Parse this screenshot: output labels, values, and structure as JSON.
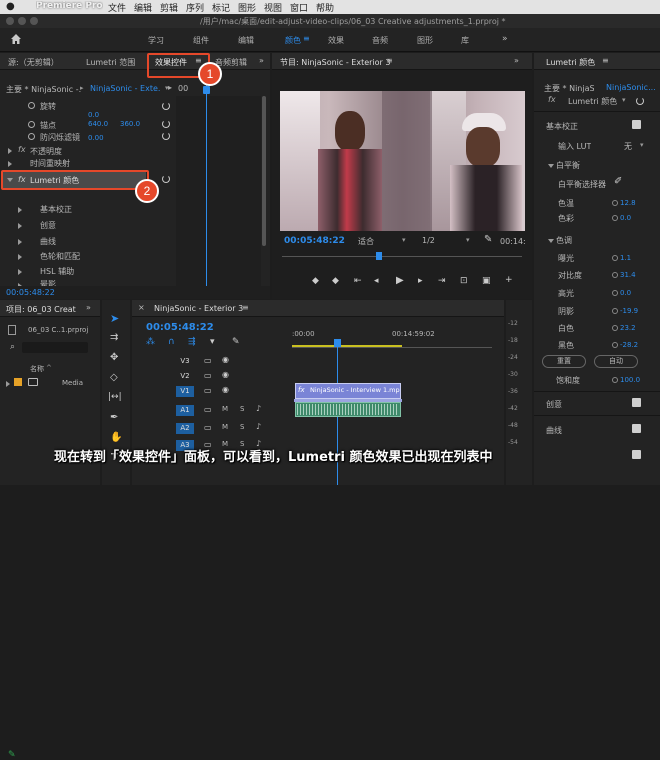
{
  "menubar": {
    "app": "Premiere Pro",
    "items": [
      "文件",
      "编辑",
      "剪辑",
      "序列",
      "标记",
      "图形",
      "视图",
      "窗口",
      "帮助"
    ]
  },
  "titlebar": {
    "path": "/用户/mac/桌面/edit-adjust-video-clips/06_03 Creative adjustments_1.prproj *"
  },
  "workspaces": {
    "items": [
      "学习",
      "组件",
      "编辑",
      "颜色",
      "效果",
      "音频",
      "图形",
      "库"
    ],
    "active": "颜色"
  },
  "source_panel": {
    "tab_source": "源:（无剪辑）",
    "tab_scope": "Lumetri 范围",
    "tab_effects": "效果控件",
    "tab_audio": "音频剪辑",
    "master": "主要 * NinjaSonic -...",
    "seq": "NinjaSonic - Exte...",
    "time0": "00",
    "rows": {
      "rotate": "旋转",
      "rotate_val": "0.0",
      "anchor": "锚点",
      "anchor_x": "640.0",
      "anchor_y": "360.0",
      "flicker": "防闪烁滤镜",
      "flicker_val": "0.00",
      "opacity": "不透明度",
      "remap": "时间重映射",
      "lumetri": "Lumetri 颜色",
      "basic": "基本校正",
      "creative": "创意",
      "curves": "曲线",
      "wheels": "色轮和匹配",
      "hsl": "HSL 辅助",
      "vignette": "晕影"
    },
    "timecode": "00:05:48:22"
  },
  "program": {
    "title": "节目: NinjaSonic - Exterior 3",
    "timecode": "00:05:48:22",
    "fit": "适合",
    "quality": "1/2",
    "end": "00:14:"
  },
  "project": {
    "title": "项目: 06_03 Creati",
    "file": "06_03 C..1.prproj",
    "col_name": "名称",
    "bin": "Media"
  },
  "timeline": {
    "tab": "NinjaSonic - Exterior 3",
    "timecode": "00:05:48:22",
    "ruler0": ":00:00",
    "ruler1": "00:14:59:02",
    "tracks": [
      "V3",
      "V2",
      "V1",
      "A1",
      "A2",
      "A3"
    ],
    "clip_v1": "NinjaSonic - Interview 1.mp",
    "m": "M",
    "s": "S"
  },
  "meter": {
    "scale": [
      "-12",
      "-18",
      "-24",
      "-30",
      "-36",
      "-42",
      "-48",
      "-54"
    ]
  },
  "lumetri": {
    "title": "Lumetri 颜色",
    "master": "主要 * NinjaS...",
    "seq": "NinjaSonic...",
    "fx": "Lumetri 颜色",
    "basic": "基本校正",
    "lut_label": "输入 LUT",
    "lut_value": "无",
    "wb": "白平衡",
    "wb_picker": "白平衡选择器",
    "temp": "色温",
    "temp_val": "12.8",
    "tint": "色彩",
    "tint_val": "0.0",
    "tone": "色调",
    "exposure": "曝光",
    "exposure_val": "1.1",
    "contrast": "对比度",
    "contrast_val": "31.4",
    "highlights": "高光",
    "highlights_val": "0.0",
    "shadows": "阴影",
    "shadows_val": "-19.9",
    "whites": "白色",
    "whites_val": "23.2",
    "blacks": "黑色",
    "blacks_val": "-28.2",
    "reset": "重置",
    "auto": "自动",
    "saturation": "饱和度",
    "saturation_val": "100.0",
    "creative": "创意",
    "curves": "曲线"
  },
  "callouts": {
    "n1": "1",
    "n2": "2"
  },
  "caption": "现在转到「效果控件」面板，可以看到，Lumetri 颜色效果已出现在列表中",
  "colors": {
    "accent": "#2d8ceb",
    "callout": "#e5482a"
  }
}
